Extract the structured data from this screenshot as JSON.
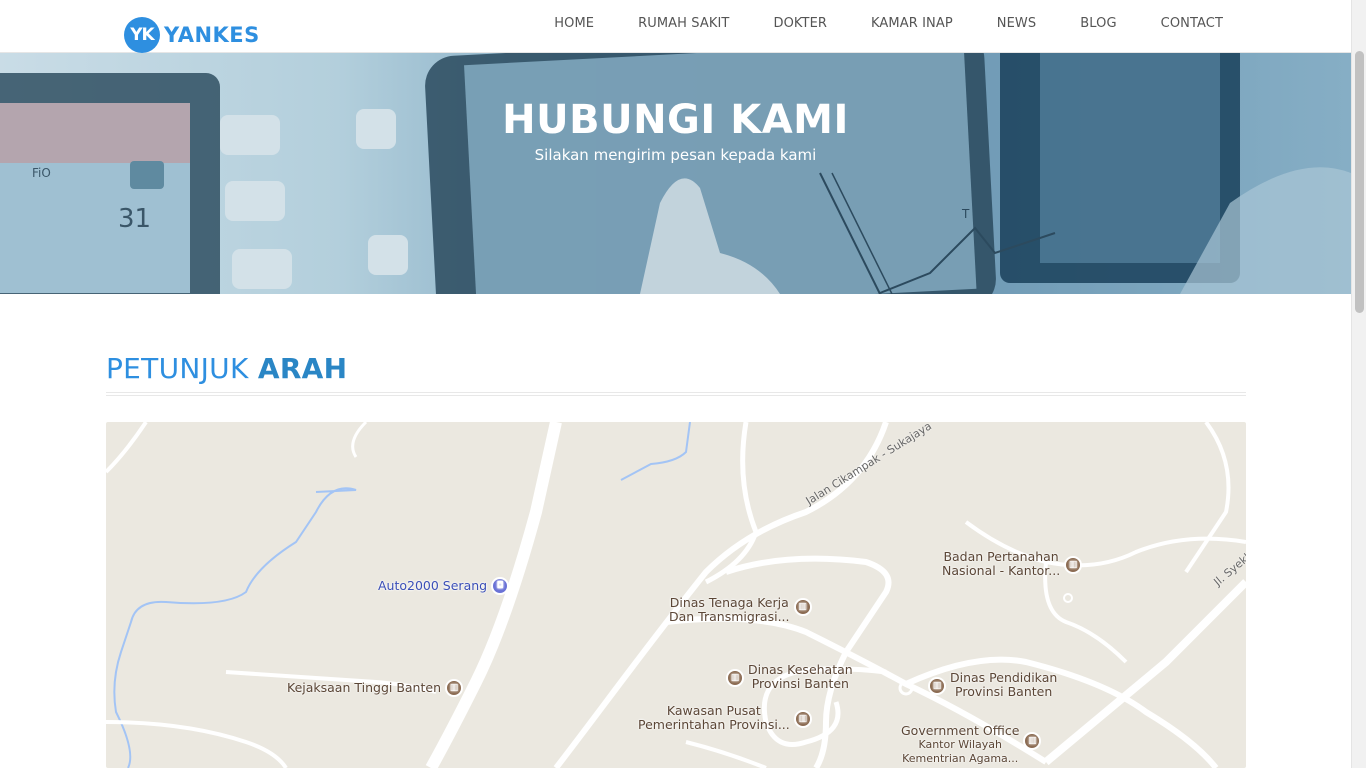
{
  "brand": {
    "mark": "YK",
    "name": "YANKES"
  },
  "nav": {
    "home": "HOME",
    "rumah_sakit": "RUMAH SAKIT",
    "dokter": "DOKTER",
    "kamar_inap": "KAMAR INAP",
    "news": "NEWS",
    "blog": "BLOG",
    "contact": "CONTACT"
  },
  "hero": {
    "title": "HUBUNGI KAMI",
    "subtitle": "Silakan mengirim pesan kepada kami"
  },
  "section": {
    "title_light": "PETUNJUK ",
    "title_bold": "ARAH"
  },
  "map": {
    "roads": {
      "cikampak": "Jalan Cikampak - Sukajaya",
      "syekh": "Jl. Syekh"
    },
    "places": {
      "badan_line1": "Badan Pertanahan",
      "badan_line2": "Nasional - Kantor...",
      "auto2000": "Auto2000 Serang",
      "disnaker_line1": "Dinas Tenaga Kerja",
      "disnaker_line2": "Dan Transmigrasi...",
      "dinkes_line1": "Dinas Kesehatan",
      "dinkes_line2": "Provinsi Banten",
      "kejaksaan": "Kejaksaan Tinggi Banten",
      "dindik_line1": "Dinas Pendidikan",
      "dindik_line2": "Provinsi Banten",
      "kp3b_line1": "Kawasan Pusat",
      "kp3b_line2": "Pemerintahan Provinsi...",
      "gov_line1": "Government Office",
      "gov_line2": "Kantor Wilayah",
      "gov_line3": "Kementrian Agama..."
    }
  },
  "colors": {
    "accent": "#2e8fe0",
    "hero_overlay": "#7fa9c2",
    "map_bg": "#ebe8e0",
    "poi": "#8b6b52"
  }
}
